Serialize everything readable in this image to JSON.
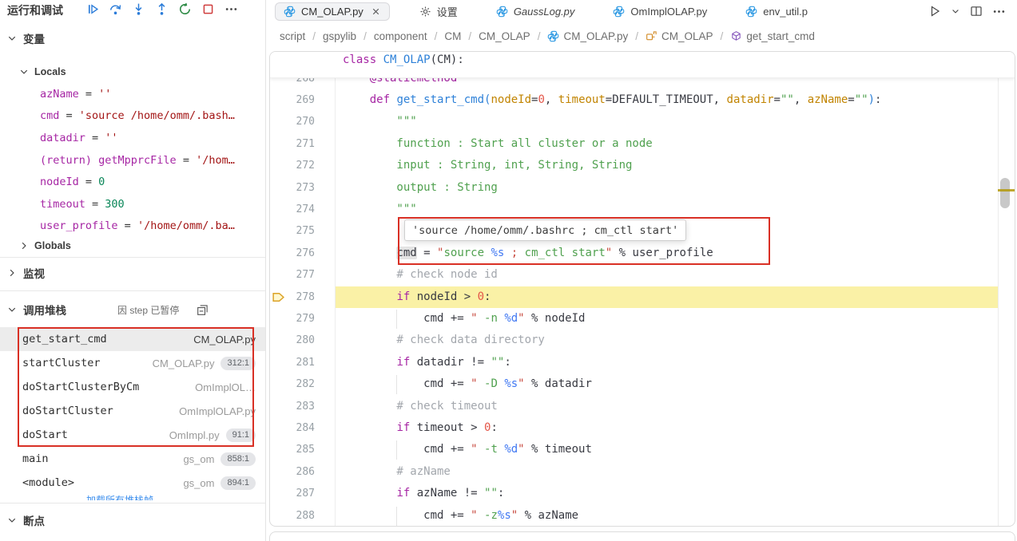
{
  "sidebar": {
    "title": "运行和调试",
    "toolbar_icons": [
      "continue",
      "step-over",
      "step-into",
      "step-out",
      "restart",
      "stop",
      "more"
    ],
    "variables_label": "变量",
    "locals_label": "Locals",
    "globals_label": "Globals",
    "watch_label": "监视",
    "callstack_label": "调用堆栈",
    "paused_text": "因 step 已暂停",
    "collapse_icon": "collapse-all",
    "breakpoints_label": "断点",
    "load_more_label": "加载所有堆栈帧",
    "variables": [
      {
        "name": "azName",
        "value": "''",
        "vt": "str"
      },
      {
        "name": "cmd",
        "value": "'source /home/omm/.bash…",
        "vt": "str"
      },
      {
        "name": "datadir",
        "value": "''",
        "vt": "str"
      },
      {
        "name": "(return) getMpprcFile",
        "value": "'/hom…",
        "vt": "str"
      },
      {
        "name": "nodeId",
        "value": "0",
        "vt": "num"
      },
      {
        "name": "timeout",
        "value": "300",
        "vt": "num"
      },
      {
        "name": "user_profile",
        "value": "'/home/omm/.ba…",
        "vt": "str"
      }
    ],
    "call_stack": [
      {
        "fn": "get_start_cmd",
        "file": "CM_OLAP.py",
        "badge": "",
        "selected": true
      },
      {
        "fn": "startCluster",
        "file": "CM_OLAP.py",
        "badge": "312:1",
        "selected": false
      },
      {
        "fn": "doStartClusterByCm",
        "file": "OmImplOL…",
        "badge": "",
        "selected": false
      },
      {
        "fn": "doStartCluster",
        "file": "OmImplOLAP.py",
        "badge": "",
        "selected": false
      },
      {
        "fn": "doStart",
        "file": "OmImpl.py",
        "badge": "91:1",
        "selected": false
      },
      {
        "fn": "main",
        "file": "gs_om",
        "badge": "858:1",
        "selected": false
      },
      {
        "fn": "<module>",
        "file": "gs_om",
        "badge": "894:1",
        "selected": false
      }
    ]
  },
  "tabs": [
    {
      "label": "CM_OLAP.py",
      "icon": "python",
      "active": true,
      "close": true,
      "preview": false
    },
    {
      "label": "设置",
      "icon": "gear",
      "active": false,
      "close": false,
      "preview": false
    },
    {
      "label": "GaussLog.py",
      "icon": "python",
      "active": false,
      "close": false,
      "preview": true
    },
    {
      "label": "OmImplOLAP.py",
      "icon": "python",
      "active": false,
      "close": false,
      "preview": false
    },
    {
      "label": "env_util.p",
      "icon": "python",
      "active": false,
      "close": false,
      "preview": false
    }
  ],
  "tab_actions": [
    "run",
    "run-dropdown",
    "split-editor",
    "more"
  ],
  "breadcrumbs": [
    {
      "label": "script",
      "icon": ""
    },
    {
      "label": "gspylib",
      "icon": ""
    },
    {
      "label": "component",
      "icon": ""
    },
    {
      "label": "CM",
      "icon": ""
    },
    {
      "label": "CM_OLAP",
      "icon": ""
    },
    {
      "label": "CM_OLAP.py",
      "icon": "python"
    },
    {
      "label": "CM_OLAP",
      "icon": "class"
    },
    {
      "label": "get_start_cmd",
      "icon": "method"
    }
  ],
  "editor": {
    "sticky_tokens": [
      [
        "k",
        "class"
      ],
      [
        "p",
        " "
      ],
      [
        "f",
        "CM_OLAP"
      ],
      [
        "p",
        "(CM):"
      ]
    ],
    "tooltip_text": "'source /home/omm/.bashrc ; cm_ctl start'",
    "current_line": 278,
    "guide_lines": [
      279,
      282,
      285,
      288
    ],
    "lines": [
      {
        "n": 268,
        "t": [
          [
            "k",
            "    @staticmethod"
          ]
        ]
      },
      {
        "n": 269,
        "t": [
          [
            "p",
            "    "
          ],
          [
            "k",
            "def"
          ],
          [
            "p",
            " "
          ],
          [
            "f",
            "get_start_cmd"
          ],
          [
            "f",
            "("
          ],
          [
            "pr",
            "nodeId"
          ],
          [
            "p",
            "="
          ],
          [
            "n",
            "0"
          ],
          [
            "p",
            ", "
          ],
          [
            "pr",
            "timeout"
          ],
          [
            "p",
            "="
          ],
          [
            "p",
            "DEFAULT_TIMEOUT"
          ],
          [
            "p",
            ", "
          ],
          [
            "pr",
            "datadir"
          ],
          [
            "p",
            "="
          ],
          [
            "sg",
            "\"\""
          ],
          [
            "p",
            ", "
          ],
          [
            "pr",
            "azName"
          ],
          [
            "p",
            "="
          ],
          [
            "sg",
            "\"\""
          ],
          [
            "f",
            ")"
          ],
          [
            "p",
            ":"
          ]
        ]
      },
      {
        "n": 270,
        "t": [
          [
            "d",
            "        \"\"\""
          ]
        ]
      },
      {
        "n": 271,
        "t": [
          [
            "d",
            "        function : Start all cluster or a node"
          ]
        ]
      },
      {
        "n": 272,
        "t": [
          [
            "d",
            "        input : String, int, String, String"
          ]
        ]
      },
      {
        "n": 273,
        "t": [
          [
            "d",
            "        output : String"
          ]
        ]
      },
      {
        "n": 274,
        "t": [
          [
            "d",
            "        \"\"\""
          ]
        ]
      },
      {
        "n": 275,
        "t": []
      },
      {
        "n": 276,
        "t": [
          [
            "p",
            "        "
          ],
          [
            "p whl",
            "cmd"
          ],
          [
            "p",
            " = "
          ],
          [
            "s",
            "\""
          ],
          [
            "sg",
            "source "
          ],
          [
            "fm",
            "%s"
          ],
          [
            "s",
            " ; "
          ],
          [
            "sg",
            "cm_ctl start"
          ],
          [
            "s",
            "\""
          ],
          [
            "p",
            " % "
          ],
          [
            "p",
            "user_profile"
          ]
        ]
      },
      {
        "n": 277,
        "t": [
          [
            "c",
            "        # check node id"
          ]
        ]
      },
      {
        "n": 278,
        "t": [
          [
            "p",
            "        "
          ],
          [
            "k",
            "if"
          ],
          [
            "p",
            " nodeId > "
          ],
          [
            "n",
            "0"
          ],
          [
            "p",
            ":"
          ]
        ]
      },
      {
        "n": 279,
        "t": [
          [
            "p",
            "            cmd += "
          ],
          [
            "s",
            "\""
          ],
          [
            "sg",
            " -n "
          ],
          [
            "fm",
            "%d"
          ],
          [
            "s",
            "\""
          ],
          [
            "p",
            " % nodeId"
          ]
        ]
      },
      {
        "n": 280,
        "t": [
          [
            "c",
            "        # check data directory"
          ]
        ]
      },
      {
        "n": 281,
        "t": [
          [
            "p",
            "        "
          ],
          [
            "k",
            "if"
          ],
          [
            "p",
            " datadir != "
          ],
          [
            "sg",
            "\"\""
          ],
          [
            "p",
            ":"
          ]
        ]
      },
      {
        "n": 282,
        "t": [
          [
            "p",
            "            cmd += "
          ],
          [
            "s",
            "\""
          ],
          [
            "sg",
            " -D "
          ],
          [
            "fm",
            "%s"
          ],
          [
            "s",
            "\""
          ],
          [
            "p",
            " % datadir"
          ]
        ]
      },
      {
        "n": 283,
        "t": [
          [
            "c",
            "        # check timeout"
          ]
        ]
      },
      {
        "n": 284,
        "t": [
          [
            "p",
            "        "
          ],
          [
            "k",
            "if"
          ],
          [
            "p",
            " timeout > "
          ],
          [
            "n",
            "0"
          ],
          [
            "p",
            ":"
          ]
        ]
      },
      {
        "n": 285,
        "t": [
          [
            "p",
            "            cmd += "
          ],
          [
            "s",
            "\""
          ],
          [
            "sg",
            " -t "
          ],
          [
            "fm",
            "%d"
          ],
          [
            "s",
            "\""
          ],
          [
            "p",
            " % timeout"
          ]
        ]
      },
      {
        "n": 286,
        "t": [
          [
            "c",
            "        # azName"
          ]
        ]
      },
      {
        "n": 287,
        "t": [
          [
            "p",
            "        "
          ],
          [
            "k",
            "if"
          ],
          [
            "p",
            " azName != "
          ],
          [
            "sg",
            "\"\""
          ],
          [
            "p",
            ":"
          ]
        ]
      },
      {
        "n": 288,
        "t": [
          [
            "p",
            "            cmd += "
          ],
          [
            "s",
            "\""
          ],
          [
            "sg",
            " -z"
          ],
          [
            "fm",
            "%s"
          ],
          [
            "s",
            "\""
          ],
          [
            "p",
            " % azName"
          ]
        ]
      }
    ]
  },
  "colors": {
    "keyword": "#a626a4",
    "function": "#2e81d8",
    "param": "#c18401",
    "number": "#e45649",
    "string_punct": "#c84a3f",
    "string_word": "#50a14f",
    "format_spec": "#4078f2",
    "docstring": "#50a14f",
    "comment": "#a3a7ad",
    "plain": "#383a42",
    "current_line_bg": "#faf1a6",
    "annotation_red": "#d93025",
    "sidebar_var_name": "#a626a4",
    "sidebar_str": "#a31515",
    "sidebar_num": "#098658",
    "debug_icon_blue": "#2b7cd9",
    "restart_green": "#2e8b46",
    "stop_red": "#cf3d3d",
    "python_icon_blue": "#2f9ae3",
    "class_icon_orange": "#d28b26",
    "method_icon_purple": "#8250ba"
  }
}
